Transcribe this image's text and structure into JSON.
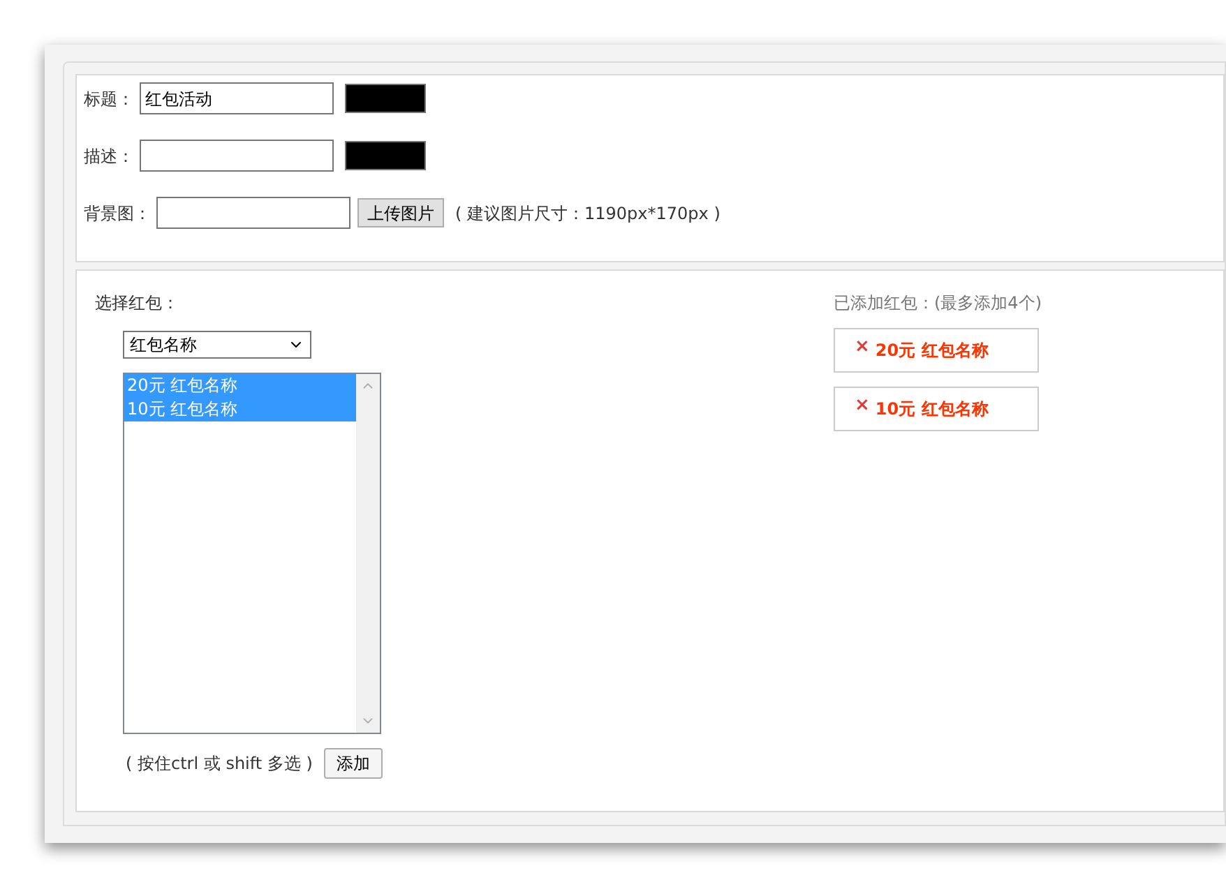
{
  "form": {
    "fields": [
      {
        "kind": "text",
        "label": "标题：",
        "value": "红包活动",
        "color": "#000000"
      },
      {
        "kind": "text",
        "label": "描述：",
        "color": "#000000"
      },
      {
        "kind": "upload",
        "label": "背景图：",
        "button": "上传图片",
        "hint": "( 建议图片尺寸：1190px*170px )"
      }
    ]
  },
  "picker": {
    "label": "选择红包：",
    "dropdown": "红包名称",
    "options": [
      {
        "text": "20元 红包名称",
        "selected": true
      },
      {
        "text": "10元 红包名称",
        "selected": true
      }
    ],
    "hint": "( 按住ctrl 或 shift 多选 )",
    "add_button": "添加"
  },
  "added": {
    "label": "已添加红包：(最多添加4个)",
    "items": [
      {
        "remove": "×",
        "text": "20元 红包名称"
      },
      {
        "remove": "×",
        "text": "10元 红包名称"
      }
    ]
  }
}
